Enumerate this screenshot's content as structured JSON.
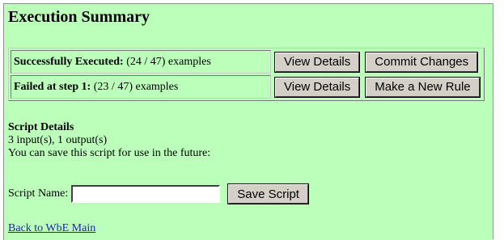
{
  "page": {
    "title": "Execution Summary"
  },
  "summary": {
    "rows": [
      {
        "label_bold": "Successfully Executed:",
        "label_rest": " (24 / 47) examples",
        "view_button": "View Details",
        "action_button": "Commit Changes"
      },
      {
        "label_bold": "Failed at step 1:",
        "label_rest": " (23 / 47) examples",
        "view_button": "View Details",
        "action_button": "Make a New Rule"
      }
    ]
  },
  "script_details": {
    "heading": "Script Details",
    "io_summary": "3 input(s), 1 output(s)",
    "save_hint": "You can save this script for use in the future:"
  },
  "save_form": {
    "label": "Script Name:",
    "input_value": "",
    "input_placeholder": "",
    "save_button": "Save Script"
  },
  "footer": {
    "back_link": "Back to WbE Main"
  }
}
